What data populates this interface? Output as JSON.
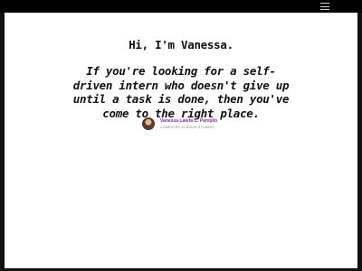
{
  "nav": {
    "menu_icon": "hamburger-menu-icon"
  },
  "hero": {
    "greeting": "Hi, I'm Vanessa.",
    "line1": "If you're looking for a self-",
    "line2": "driven intern who doesn't give up",
    "line3": "until a task is done, then you've",
    "line4": "come to the right place."
  },
  "author": {
    "name": "Vanessa Latefa C. Pampilo",
    "title": "COMPUTER SCIENCE STUDENT",
    "avatar_icon": "profile-avatar"
  },
  "colors": {
    "accent": "#8e24aa",
    "frame": "#111111",
    "background": "#ffffff"
  }
}
